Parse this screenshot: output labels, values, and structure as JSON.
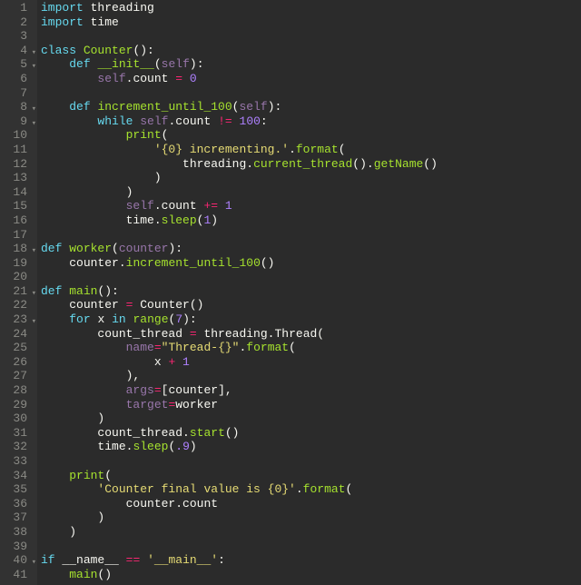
{
  "colors": {
    "keyword": "#66d9ef",
    "operator": "#f92672",
    "string": "#e6db74",
    "number": "#ae81ff",
    "function": "#a6e22e",
    "text": "#f8f8f2",
    "bg": "#2b2b2b",
    "gutter": "#323232"
  },
  "fold_marker": "▾",
  "gutter": {
    "line_count": 41,
    "fold_lines": [
      4,
      5,
      8,
      9,
      18,
      21,
      23,
      40
    ]
  },
  "tokens": {
    "kw_import": "import",
    "kw_class": "class",
    "kw_def": "def",
    "kw_while": "while",
    "kw_for": "for",
    "kw_in": "in",
    "kw_if": "if",
    "mod_threading": "threading",
    "mod_time": "time",
    "cls_Counter": "Counter",
    "fn_init": "__init__",
    "arg_self": "self",
    "attr_count": "count",
    "num_0": "0",
    "fn_inc100": "increment_until_100",
    "eq": " = ",
    "ne": " != ",
    "pe": " += ",
    "eq2": " == ",
    "num_100": "100",
    "fn_print": "print",
    "str_incrementing": "'{0} incrementing.'",
    "fn_format": "format",
    "fn_current_thread": "current_thread",
    "fn_getName": "getName",
    "num_1": "1",
    "fn_sleep": "sleep",
    "fn_worker": "worker",
    "arg_counter": "counter",
    "fn_main": "main",
    "var_counter": "counter",
    "var_x": "x",
    "fn_range": "range",
    "num_7": "7",
    "var_count_thread": "count_thread",
    "cls_Thread": "Thread",
    "kw_name": "name",
    "str_threadfmt": "\"Thread-{}\"",
    "plus": " + ",
    "kw_args": "args",
    "kw_target": "target",
    "fn_start": "start",
    "num_p9": ".9",
    "str_final": "'Counter final value is {0}'",
    "dunder_name": "__name__",
    "str_main": "'__main__'"
  },
  "source_lines": [
    "import threading",
    "import time",
    "",
    "class Counter():",
    "    def __init__(self):",
    "        self.count = 0",
    "",
    "    def increment_until_100(self):",
    "        while self.count != 100:",
    "            print(",
    "                '{0} incrementing.'.format(",
    "                    threading.current_thread().getName()",
    "                )",
    "            )",
    "            self.count += 1",
    "            time.sleep(1)",
    "",
    "def worker(counter):",
    "    counter.increment_until_100()",
    "",
    "def main():",
    "    counter = Counter()",
    "    for x in range(7):",
    "        count_thread = threading.Thread(",
    "            name=\"Thread-{}\".format(",
    "                x + 1",
    "            ),",
    "            args=[counter],",
    "            target=worker",
    "        )",
    "        count_thread.start()",
    "        time.sleep(.9)",
    "",
    "    print(",
    "        'Counter final value is {0}'.format(",
    "            counter.count",
    "        )",
    "    )",
    "",
    "if __name__ == '__main__':",
    "    main()"
  ]
}
